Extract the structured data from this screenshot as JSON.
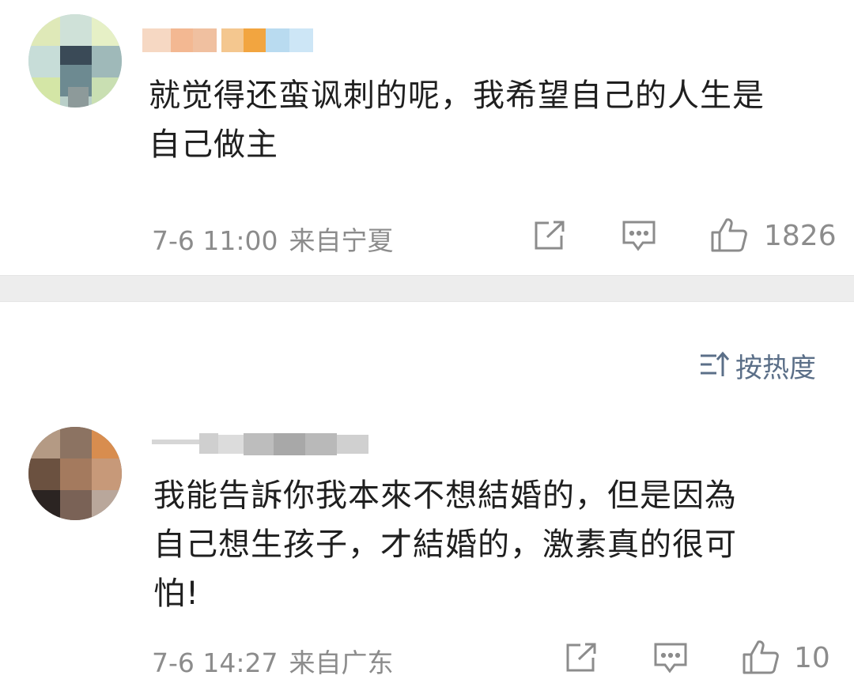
{
  "comments": [
    {
      "text_lines": [
        "就觉得还蛮讽刺的呢，我希望自己的人生是",
        "自己做主"
      ],
      "time": "7-6 11:00",
      "location": "来自宁夏",
      "like_count": "1826",
      "icons": {
        "share": "share-icon",
        "comment": "comment-icon",
        "like": "thumbs-up-icon"
      }
    },
    {
      "text_lines": [
        "我能告訴你我本來不想結婚的，但是因為",
        "自己想生孩子，才結婚的，激素真的很可",
        "怕!"
      ],
      "time": "7-6 14:27",
      "location": "来自广东",
      "like_count": "10",
      "icons": {
        "share": "share-icon",
        "comment": "comment-icon",
        "like": "thumbs-up-icon"
      }
    }
  ],
  "sort": {
    "label": "按热度",
    "icon": "sort-icon"
  },
  "colors": {
    "text": "#1f1f1f",
    "meta": "#8c8c8c",
    "divider": "#ededed",
    "sort": "#5b6f88"
  }
}
